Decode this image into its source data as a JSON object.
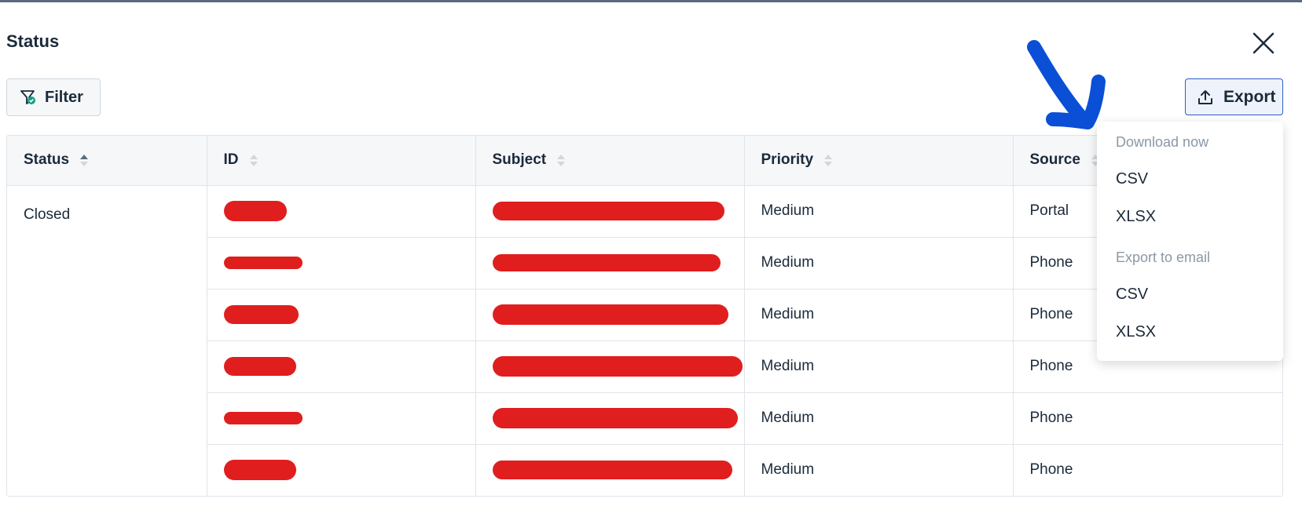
{
  "header": {
    "title": "Status"
  },
  "toolbar": {
    "filter_label": "Filter",
    "export_label": "Export"
  },
  "table": {
    "columns": [
      "Status",
      "ID",
      "Subject",
      "Priority",
      "Source"
    ],
    "group_status": "Closed",
    "rows": [
      {
        "priority": "Medium",
        "source": "Portal"
      },
      {
        "priority": "Medium",
        "source": "Phone"
      },
      {
        "priority": "Medium",
        "source": "Phone"
      },
      {
        "priority": "Medium",
        "source": "Phone"
      },
      {
        "priority": "Medium",
        "source": "Phone"
      },
      {
        "priority": "Medium",
        "source": "Phone"
      }
    ]
  },
  "export_menu": {
    "group1": "Download now",
    "group1_items": [
      "CSV",
      "XLSX"
    ],
    "group2": "Export to email",
    "group2_items": [
      "CSV",
      "XLSX"
    ]
  },
  "colors": {
    "accent": "#2c5cc5",
    "redaction": "#e01e1e",
    "annotation": "#0a4fd6"
  },
  "icons": {
    "close": "close-icon",
    "filter": "filter-icon",
    "export": "upload-icon",
    "sort": "sort-icon"
  }
}
